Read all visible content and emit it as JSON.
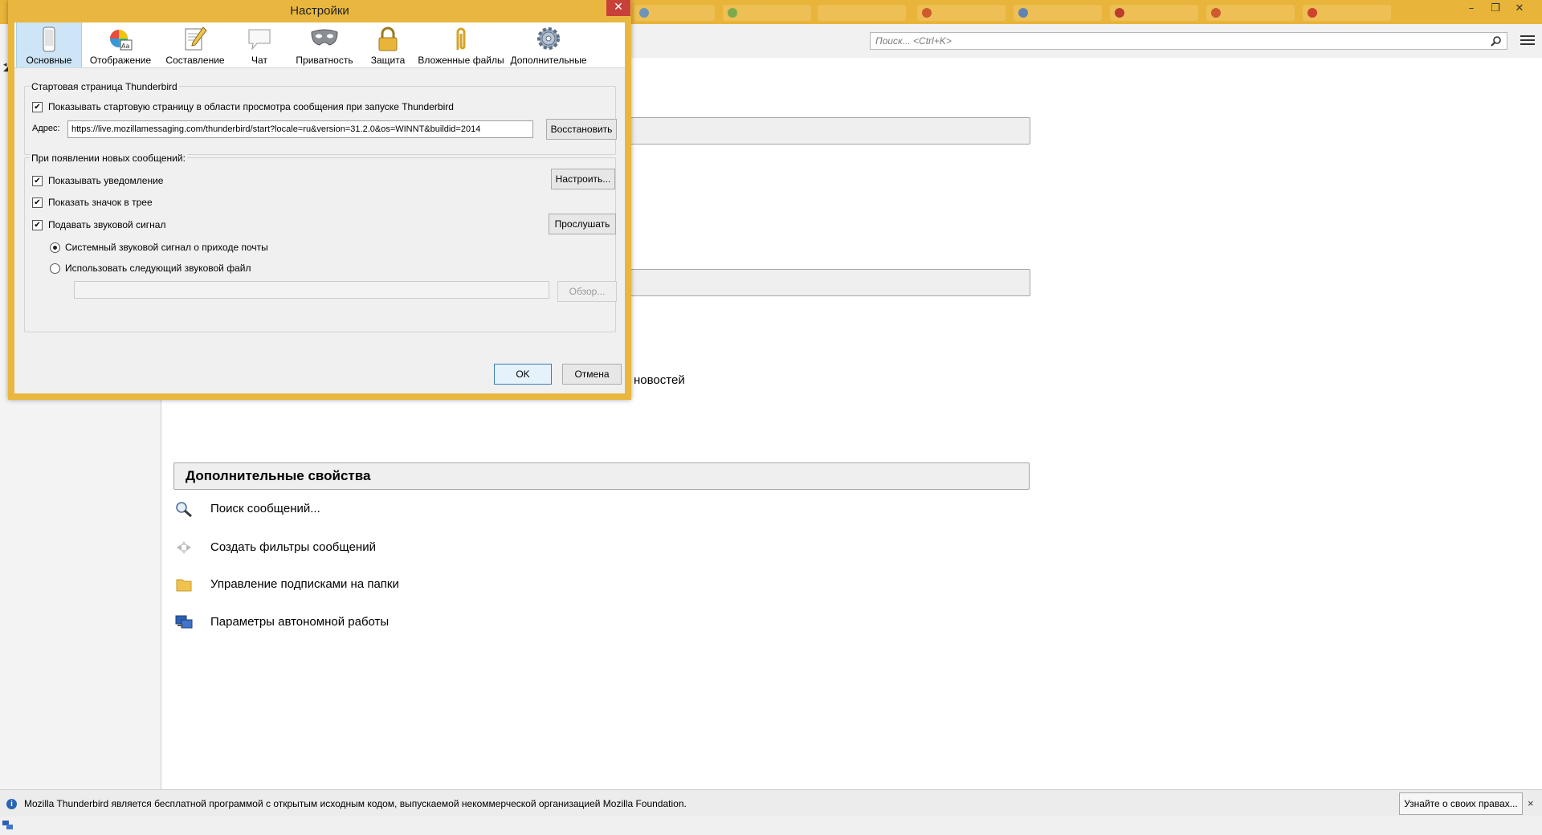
{
  "dialog": {
    "title": "Настройки",
    "tabs": [
      {
        "label": "Основные",
        "icon": "general-icon",
        "selected": true
      },
      {
        "label": "Отображение",
        "icon": "display-icon",
        "selected": false
      },
      {
        "label": "Составление",
        "icon": "compose-icon",
        "selected": false
      },
      {
        "label": "Чат",
        "icon": "chat-icon",
        "selected": false
      },
      {
        "label": "Приватность",
        "icon": "privacy-mask-icon",
        "selected": false
      },
      {
        "label": "Защита",
        "icon": "lock-icon",
        "selected": false
      },
      {
        "label": "Вложенные файлы",
        "icon": "paperclip-icon",
        "selected": false
      },
      {
        "label": "Дополнительные",
        "icon": "gear-icon",
        "selected": false
      }
    ],
    "startpage": {
      "group_label": "Стартовая страница Thunderbird",
      "show_checkbox_label": "Показывать стартовую страницу в области просмотра сообщения при запуске Thunderbird",
      "show_checked": true,
      "address_label": "Адрес:",
      "address_value": "https://live.mozillamessaging.com/thunderbird/start?locale=ru&version=31.2.0&os=WINNT&buildid=2014",
      "restore_button": "Восстановить"
    },
    "newmail": {
      "group_label": "При появлении новых сообщений:",
      "show_alert_label": "Показывать уведомление",
      "show_alert_checked": true,
      "configure_button": "Настроить...",
      "show_tray_label": "Показать значок в трее",
      "show_tray_checked": true,
      "play_sound_label": "Подавать звуковой сигнал",
      "play_sound_checked": true,
      "listen_button": "Прослушать",
      "radio_system": "Системный звуковой сигнал о приходе почты",
      "radio_file": "Использовать следующий звуковой файл",
      "browse_button": "Обзор..."
    },
    "ok_button": "OK",
    "cancel_button": "Отмена"
  },
  "window": {
    "search_placeholder": "Поиск... <Ctrl+K>",
    "partial_text": "новостей",
    "advanced_title": "Дополнительные свойства",
    "actions": [
      {
        "label": "Поиск сообщений...",
        "icon": "magnifier-icon"
      },
      {
        "label": "Создать фильтры сообщений",
        "icon": "filter-arrows-icon"
      },
      {
        "label": "Управление подписками на папки",
        "icon": "folder-icon"
      },
      {
        "label": "Параметры автономной работы",
        "icon": "offline-computer-icon"
      }
    ]
  },
  "status": {
    "info_text": "Mozilla Thunderbird является бесплатной программой с открытым исходным кодом, выпускаемой некоммерческой организацией Mozilla Foundation.",
    "rights_button": "Узнайте о своих правах...",
    "close": "×"
  },
  "colors": {
    "titlebar": "#e8b43a",
    "selected_tab": "#cde5f7",
    "close_button": "#c7403a"
  }
}
